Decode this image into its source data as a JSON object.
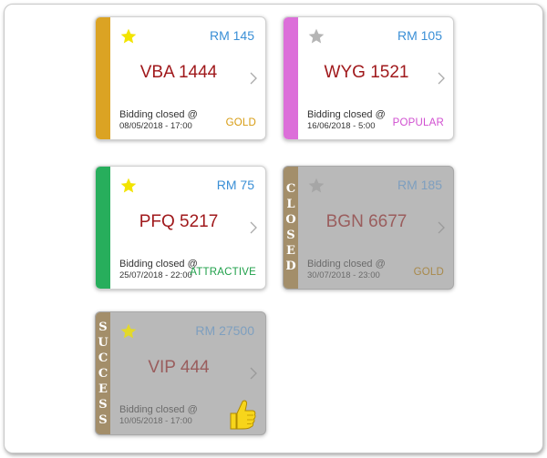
{
  "cards": [
    {
      "price": "RM 145",
      "plate": "VBA 1444",
      "closed_label": "Bidding closed @",
      "closed_date": "08/05/2018 - 17:00",
      "tag": "GOLD",
      "tag_color": "#d79b10",
      "stripe_color": "#dba323",
      "starred": true,
      "state": "open"
    },
    {
      "price": "RM 105",
      "plate": "WYG 1521",
      "closed_label": "Bidding closed @",
      "closed_date": "16/06/2018 - 5:00",
      "tag": "POPULAR",
      "tag_color": "#d04fd0",
      "stripe_color": "#dc6fd9",
      "starred": false,
      "state": "open"
    },
    {
      "price": "RM 75",
      "plate": "PFQ 5217",
      "closed_label": "Bidding closed @",
      "closed_date": "25/07/2018 - 22:00",
      "tag": "ATTRACTIVE",
      "tag_color": "#1fa04a",
      "stripe_color": "#27ae5c",
      "starred": true,
      "state": "open"
    },
    {
      "price": "RM 185",
      "plate": "BGN 6677",
      "closed_label": "Bidding closed @",
      "closed_date": "30/07/2018 - 23:00",
      "tag": "GOLD",
      "tag_color": "#a8894a",
      "stripe_color": "#a38e6a",
      "stripe_text": "CLOSED",
      "starred": false,
      "state": "closed"
    },
    {
      "price": "RM 27500",
      "plate": "VIP 444",
      "closed_label": "Bidding closed @",
      "closed_date": "10/05/2018 - 17:00",
      "stripe_color": "#a38e6a",
      "stripe_text": "SUCCESS",
      "starred": true,
      "state": "success",
      "badge_icon": "thumbs-up-icon"
    }
  ],
  "colors": {
    "star_active": "#f2e400",
    "star_inactive": "#b5b5b5",
    "price": "#3a8fd6",
    "plate": "#a0191c",
    "dim_background": "#b9b9b9",
    "thumb": "#f7d51b"
  }
}
